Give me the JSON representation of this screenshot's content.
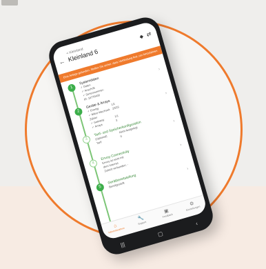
{
  "header": {
    "breadcrumb": "< Kleinland",
    "title": "Kleinland 6",
    "icon_1": "diamond-icon",
    "icon_2": "swap-icon"
  },
  "warning": {
    "text": "Eine Anlage gefunden. Stellen Sie sicher, dass Verbindung fest, um fortzufahren"
  },
  "steps": [
    {
      "num": "1",
      "title": "Systemdaten",
      "rows": [
        [
          "✓ Daten",
          ""
        ],
        [
          "✓ Anschrift",
          ""
        ],
        [
          "✓ Seriennummer-ID: 16779430",
          ""
        ]
      ]
    },
    {
      "num": "2",
      "title": "Geräte & Arrays",
      "rows": [
        [
          "✓ Energy",
          "1/1"
        ],
        [
          "✓ Mikro-Wechselr.",
          "23/23"
        ],
        [
          "Zähler",
          ""
        ],
        [
          "✓ Gateway",
          "1/1"
        ],
        [
          "✓ Arrays",
          "3"
        ]
      ]
    },
    {
      "num": "3",
      "title": "Tarif- und Speicherkonfiguration",
      "rows": [
        [
          "(Optional)",
          "Nicht festgelegt"
        ],
        [
          "Tarif",
          "0"
        ]
      ]
    },
    {
      "num": "4",
      "title": "Envoy Connectivity",
      "rows": [
        [
          "Envoy ist nicht mit dem Internet",
          ""
        ],
        [
          "Zuletzt verbunden: -",
          ""
        ]
      ]
    },
    {
      "num": "5",
      "title": "Gerätbereitstellung",
      "rows": [
        [
          "Bereitgestellt",
          ""
        ]
      ]
    }
  ],
  "tabs": [
    {
      "label": "Inbetriebnahme",
      "icon": "home-icon",
      "glyph": "⌂"
    },
    {
      "label": "Support",
      "icon": "wrench-icon",
      "glyph": "🔧"
    },
    {
      "label": "Feedback",
      "icon": "image-icon",
      "glyph": "▣"
    },
    {
      "label": "Einstellungen",
      "icon": "gear-icon",
      "glyph": "⚙"
    }
  ],
  "colors": {
    "accent": "#ef7a2c",
    "success": "#3cae4a"
  }
}
